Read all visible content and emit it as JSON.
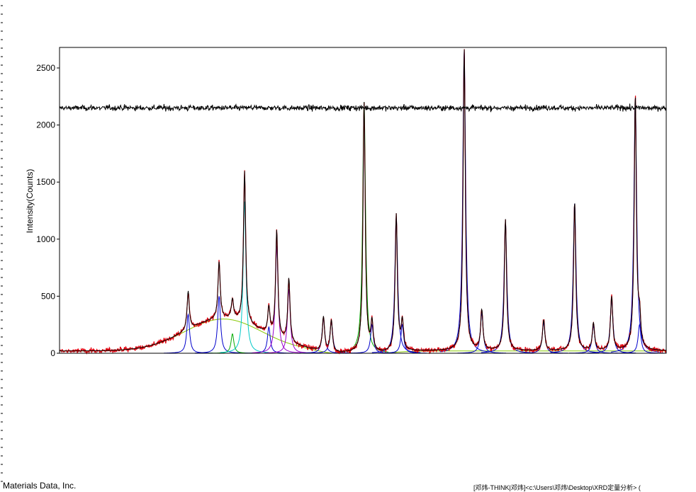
{
  "window": {
    "footer_left": "Materials Data, Inc.",
    "footer_right": "[邓炜-THINK|邓炜]<c:\\Users\\邓炜\\Desktop\\XRD定量分析> ("
  },
  "colors": {
    "observed": "#e0000e",
    "calculated": "#000000",
    "background": "#86c800",
    "residual": "#000000",
    "component_blue": "#0000cc",
    "component_cyan": "#00c8c8",
    "component_purple": "#9900cc",
    "component_green": "#00aa00"
  },
  "chart_data": {
    "type": "line",
    "title": "",
    "xlabel": "",
    "ylabel": "Intensity(Counts)",
    "ylim": [
      0,
      2680
    ],
    "yticks": [
      0,
      500,
      1000,
      1500,
      2000,
      2500
    ],
    "xlim": [
      0,
      100
    ],
    "x_tick_labels_visible": false,
    "grid": false,
    "residual_offset": 2150,
    "background_hump": {
      "center": 27,
      "height": 280,
      "width": 9,
      "baseline": 20
    },
    "peaks": [
      {
        "x": 21.2,
        "height": 340,
        "component": "blue"
      },
      {
        "x": 26.3,
        "height": 500,
        "component": "blue"
      },
      {
        "x": 28.5,
        "height": 170,
        "component": "green"
      },
      {
        "x": 30.5,
        "height": 1330,
        "component": "cyan"
      },
      {
        "x": 34.5,
        "height": 230,
        "component": "blue"
      },
      {
        "x": 35.8,
        "height": 940,
        "component": "purple"
      },
      {
        "x": 37.8,
        "height": 560,
        "component": "purple"
      },
      {
        "x": 43.5,
        "height": 300,
        "component": "blue"
      },
      {
        "x": 44.8,
        "height": 280,
        "component": "blue"
      },
      {
        "x": 50.2,
        "height": 2200,
        "component": "green"
      },
      {
        "x": 51.5,
        "height": 250,
        "component": "blue"
      },
      {
        "x": 55.5,
        "height": 1200,
        "component": "blue"
      },
      {
        "x": 56.5,
        "height": 250,
        "component": "blue"
      },
      {
        "x": 66.7,
        "height": 2650,
        "component": "blue"
      },
      {
        "x": 69.6,
        "height": 350,
        "component": "blue"
      },
      {
        "x": 73.5,
        "height": 1150,
        "component": "blue"
      },
      {
        "x": 79.8,
        "height": 270,
        "component": "blue"
      },
      {
        "x": 84.9,
        "height": 1310,
        "component": "blue"
      },
      {
        "x": 88.0,
        "height": 240,
        "component": "blue"
      },
      {
        "x": 91.0,
        "height": 470,
        "component": "blue"
      },
      {
        "x": 94.9,
        "height": 2230,
        "component": "blue"
      },
      {
        "x": 95.6,
        "height": 250,
        "component": "blue"
      }
    ],
    "series": [
      {
        "values_ref": "observed"
      },
      {
        "values_ref": "calculated"
      },
      {
        "values_ref": "background"
      },
      {
        "values_ref": "residual"
      }
    ]
  }
}
